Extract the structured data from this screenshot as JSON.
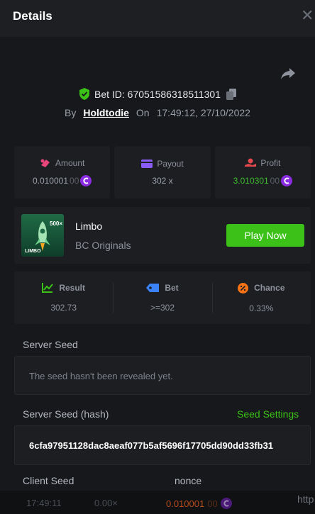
{
  "header": {
    "title": "Details",
    "close_icon": "close-icon"
  },
  "bet": {
    "id_text": "Bet ID: 67051586318511301",
    "by_label": "By",
    "username": "Holdtodie",
    "on_label": "On",
    "timestamp": "17:49:12, 27/10/2022"
  },
  "stats": {
    "amount": {
      "label": "Amount",
      "value_main": "0.010001",
      "value_dim": "00"
    },
    "payout": {
      "label": "Payout",
      "value": "302 x"
    },
    "profit": {
      "label": "Profit",
      "value_main": "3.010301",
      "value_dim": "00"
    }
  },
  "game": {
    "name": "Limbo",
    "provider": "BC Originals",
    "play_label": "Play Now",
    "thumb_text_top": "500×",
    "thumb_text_bottom": "LIMBO"
  },
  "results": {
    "result": {
      "label": "Result",
      "value": "302.73"
    },
    "bet": {
      "label": "Bet",
      "value": ">=302"
    },
    "chance": {
      "label": "Chance",
      "value": "0.33%"
    }
  },
  "seeds": {
    "server_seed_label": "Server Seed",
    "server_seed_value": "The seed hasn't been revealed yet.",
    "server_hash_label": "Server Seed (hash)",
    "seed_settings_label": "Seed Settings",
    "server_hash_value": "6cfa97951128dac8aeaf077b5af5696f17705dd90dd33fb31",
    "client_seed_label": "Client Seed",
    "nonce_label": "nonce"
  },
  "footer": {
    "time": "17:49:11",
    "multiplier": "0.00×",
    "amount_main": "0.010001",
    "amount_dim": "00",
    "url_stub": "http"
  },
  "colors": {
    "accent_green": "#3bc117",
    "amount_icon": "#e8457a",
    "payout_icon": "#8b5cf6",
    "profit_icon": "#e5484d",
    "result_icon": "#3bc117",
    "bet_icon": "#3b82f6",
    "chance_icon": "#f97316"
  }
}
